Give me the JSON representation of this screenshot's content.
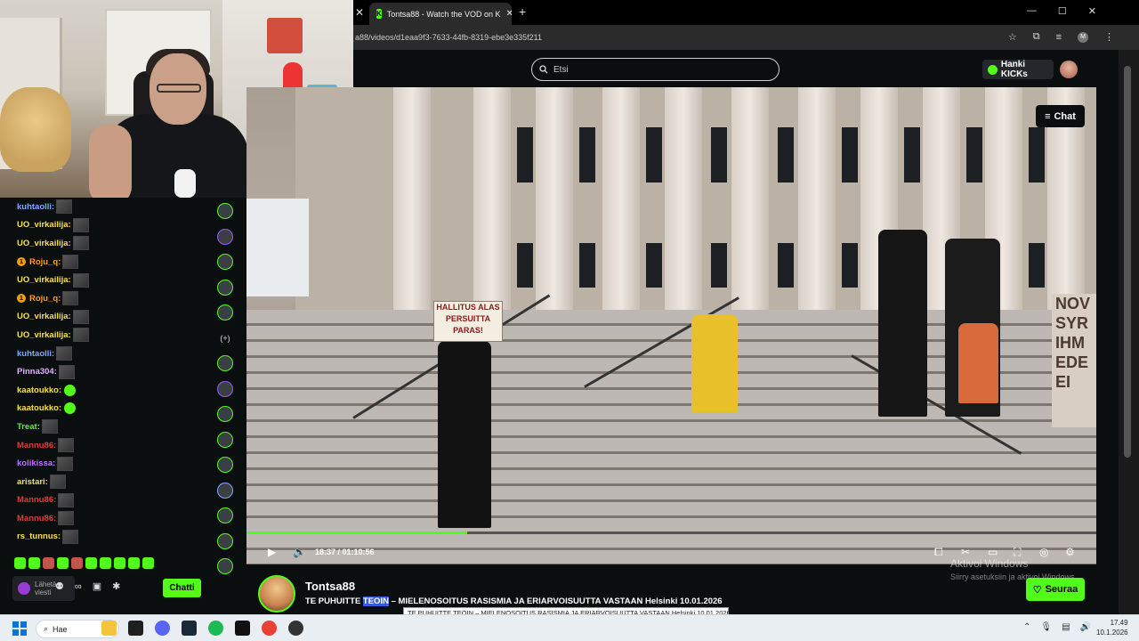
{
  "browser": {
    "tab_title": "Tontsa88 - Watch the VOD on K",
    "url": "a88/videos/d1eaa9f3-7633-44fb-8319-ebe3e335f211",
    "profile_initial": "M"
  },
  "site": {
    "search_placeholder": "Etsi",
    "get_kicks_label": "Hanki KICKs",
    "chat_toggle_label": "Chat"
  },
  "player": {
    "time": "18:37 / 01:10:56",
    "progress_fraction": 0.26
  },
  "stream": {
    "streamer": "Tontsa88",
    "title_pre": "TE PUHUITTE ",
    "title_highlight": "TEOIN",
    "title_post": " – MIELENOSOITUS RASISMIA JA ERIARVOISUUTTA VASTAAN Helsinki 10.01.2026",
    "tooltip": "TE PUHUITTE TEOIN – MIELENOSOITUS RASISMIA JA ERIARVOISUUTTA VASTAAN Helsinki 10.01.2026",
    "follow_label": "Seuraa"
  },
  "video_signs": {
    "left_sign_line1": "HALLITUS ALAS",
    "left_sign_line2": "PERSUITTA",
    "left_sign_line3": "PARAS!",
    "right_sign": "NOV\nSYR\nIHM\nEDE\nEI"
  },
  "watermark": {
    "line1": "Aktivoi Windows",
    "line2": "Siirry asetuksiin ja aktivoi Windows."
  },
  "chat": {
    "messages": [
      {
        "user": "kuhtaolli:",
        "color": "#7ea8ff",
        "badge": false,
        "emote": "box"
      },
      {
        "user": "UO_virkailija:",
        "color": "#f7e04a",
        "badge": false,
        "emote": "box"
      },
      {
        "user": "UO_virkailija:",
        "color": "#f7e04a",
        "badge": false,
        "emote": "box"
      },
      {
        "user": "Roju_q:",
        "color": "#ff9f1a",
        "badge": true,
        "emote": "box"
      },
      {
        "user": "UO_virkailija:",
        "color": "#f7e04a",
        "badge": false,
        "emote": "box"
      },
      {
        "user": "Roju_q:",
        "color": "#ff9f1a",
        "badge": true,
        "emote": "box"
      },
      {
        "user": "UO_virkailija:",
        "color": "#f7e04a",
        "badge": false,
        "emote": "box"
      },
      {
        "user": "UO_virkailija:",
        "color": "#f7e04a",
        "badge": false,
        "emote": "box"
      },
      {
        "user": "kuhtaolli:",
        "color": "#7ea8ff",
        "badge": false,
        "emote": "box"
      },
      {
        "user": "Pinna304:",
        "color": "#e0b0ff",
        "badge": false,
        "emote": "box"
      },
      {
        "user": "kaatoukko:",
        "color": "#f7e04a",
        "badge": false,
        "emote": "green"
      },
      {
        "user": "kaatoukko:",
        "color": "#f7e04a",
        "badge": false,
        "emote": "green"
      },
      {
        "user": "Treat:",
        "color": "#53fc18",
        "badge": false,
        "emote": "box"
      },
      {
        "user": "Mannu86:",
        "color": "#e23b3b",
        "badge": false,
        "emote": "box"
      },
      {
        "user": "kolikissa:",
        "color": "#c26cff",
        "badge": false,
        "emote": "box"
      },
      {
        "user": "aristari:",
        "color": "#f7e04a",
        "badge": false,
        "emote": "box"
      },
      {
        "user": "Mannu86:",
        "color": "#e23b3b",
        "badge": false,
        "emote": "box"
      },
      {
        "user": "Mannu86:",
        "color": "#e23b3b",
        "badge": false,
        "emote": "box"
      },
      {
        "user": "rs_tunnus:",
        "color": "#f7e04a",
        "badge": false,
        "emote": "box"
      }
    ],
    "input_placeholder": "Lähetä viesti",
    "send_label": "Chatti"
  },
  "taskbar": {
    "search_label": "Hae",
    "time": "17.49",
    "date": "10.1.2026"
  }
}
